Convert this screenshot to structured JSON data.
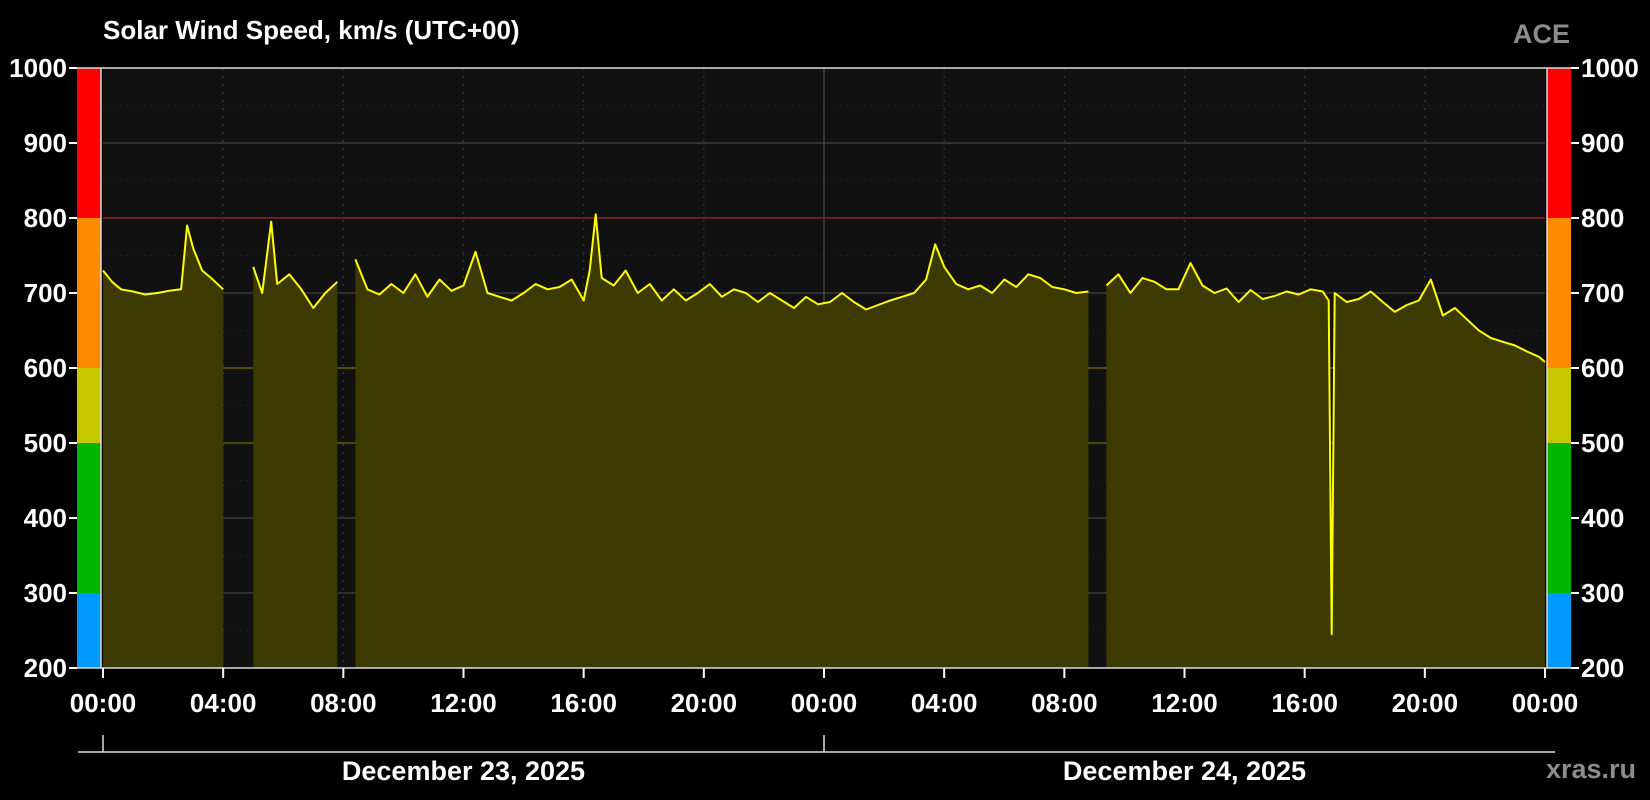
{
  "chart_data": {
    "type": "area",
    "title": "Solar Wind Speed, km/s (UTC+00)",
    "source_label": "ACE",
    "watermark": "xras.ru",
    "ylim": [
      200,
      1000
    ],
    "y_ticks": [
      200,
      300,
      400,
      500,
      600,
      700,
      800,
      900,
      1000
    ],
    "x_ticks": [
      "00:00",
      "04:00",
      "08:00",
      "12:00",
      "16:00",
      "20:00",
      "00:00",
      "04:00",
      "08:00",
      "12:00",
      "16:00",
      "20:00",
      "00:00"
    ],
    "x_range_hours": [
      0,
      48
    ],
    "date_labels": [
      {
        "label": "December 23, 2025",
        "start_hour": 0,
        "end_hour": 24
      },
      {
        "label": "December 24, 2025",
        "start_hour": 24,
        "end_hour": 48
      }
    ],
    "level_bands": [
      {
        "from": 200,
        "to": 300,
        "color": "#0099ff"
      },
      {
        "from": 300,
        "to": 500,
        "color": "#00b400"
      },
      {
        "from": 500,
        "to": 600,
        "color": "#c8c800"
      },
      {
        "from": 600,
        "to": 800,
        "color": "#ff8c00"
      },
      {
        "from": 800,
        "to": 1000,
        "color": "#ff0000"
      }
    ],
    "threshold_lines": [
      {
        "value": 800,
        "color": "#8b1a1a"
      },
      {
        "value": 600,
        "color": "#6b5a00"
      },
      {
        "value": 500,
        "color": "#5a5a00"
      }
    ],
    "colors": {
      "line": "#ffff00",
      "fill": "#3d3a00",
      "plot_background": "#111111",
      "grid": "#3a3a3a"
    },
    "grid": true,
    "series": [
      {
        "points": [
          [
            0.0,
            730
          ],
          [
            0.3,
            715
          ],
          [
            0.6,
            705
          ],
          [
            1.0,
            702
          ],
          [
            1.4,
            698
          ],
          [
            1.8,
            700
          ],
          [
            2.2,
            703
          ],
          [
            2.6,
            705
          ],
          [
            2.8,
            790
          ],
          [
            3.0,
            760
          ],
          [
            3.3,
            730
          ],
          [
            3.6,
            720
          ],
          [
            4.0,
            705
          ],
          [
            null,
            null
          ],
          [
            5.0,
            735
          ],
          [
            5.3,
            700
          ],
          [
            5.6,
            795
          ],
          [
            5.8,
            712
          ],
          [
            6.2,
            725
          ],
          [
            6.6,
            705
          ],
          [
            7.0,
            680
          ],
          [
            7.4,
            700
          ],
          [
            7.8,
            715
          ],
          [
            null,
            null
          ],
          [
            8.4,
            745
          ],
          [
            8.8,
            705
          ],
          [
            9.2,
            698
          ],
          [
            9.6,
            712
          ],
          [
            10.0,
            700
          ],
          [
            10.4,
            725
          ],
          [
            10.8,
            695
          ],
          [
            11.2,
            718
          ],
          [
            11.6,
            703
          ],
          [
            12.0,
            710
          ],
          [
            12.4,
            755
          ],
          [
            12.8,
            700
          ],
          [
            13.2,
            695
          ],
          [
            13.6,
            690
          ],
          [
            14.0,
            700
          ],
          [
            14.4,
            712
          ],
          [
            14.8,
            705
          ],
          [
            15.2,
            708
          ],
          [
            15.6,
            718
          ],
          [
            16.0,
            690
          ],
          [
            16.2,
            730
          ],
          [
            16.4,
            805
          ],
          [
            16.6,
            720
          ],
          [
            17.0,
            710
          ],
          [
            17.4,
            730
          ],
          [
            17.8,
            700
          ],
          [
            18.2,
            712
          ],
          [
            18.6,
            690
          ],
          [
            19.0,
            705
          ],
          [
            19.4,
            690
          ],
          [
            19.8,
            700
          ],
          [
            20.2,
            712
          ],
          [
            20.6,
            695
          ],
          [
            21.0,
            705
          ],
          [
            21.4,
            700
          ],
          [
            21.8,
            688
          ],
          [
            22.2,
            700
          ],
          [
            22.6,
            690
          ],
          [
            23.0,
            680
          ],
          [
            23.4,
            695
          ],
          [
            23.8,
            685
          ],
          [
            24.2,
            688
          ],
          [
            24.6,
            700
          ],
          [
            25.0,
            688
          ],
          [
            25.4,
            678
          ],
          [
            25.8,
            684
          ],
          [
            26.2,
            690
          ],
          [
            26.6,
            695
          ],
          [
            27.0,
            700
          ],
          [
            27.4,
            718
          ],
          [
            27.7,
            765
          ],
          [
            28.0,
            735
          ],
          [
            28.4,
            712
          ],
          [
            28.8,
            705
          ],
          [
            29.2,
            710
          ],
          [
            29.6,
            700
          ],
          [
            30.0,
            718
          ],
          [
            30.4,
            708
          ],
          [
            30.8,
            725
          ],
          [
            31.2,
            720
          ],
          [
            31.6,
            708
          ],
          [
            32.0,
            705
          ],
          [
            32.4,
            700
          ],
          [
            32.8,
            702
          ],
          [
            null,
            null
          ],
          [
            33.4,
            710
          ],
          [
            33.8,
            725
          ],
          [
            34.2,
            700
          ],
          [
            34.6,
            720
          ],
          [
            35.0,
            715
          ],
          [
            35.4,
            705
          ],
          [
            35.8,
            705
          ],
          [
            36.2,
            740
          ],
          [
            36.6,
            710
          ],
          [
            37.0,
            700
          ],
          [
            37.4,
            706
          ],
          [
            37.8,
            688
          ],
          [
            38.2,
            704
          ],
          [
            38.6,
            692
          ],
          [
            39.0,
            696
          ],
          [
            39.4,
            702
          ],
          [
            39.8,
            698
          ],
          [
            40.2,
            705
          ],
          [
            40.6,
            702
          ],
          [
            40.8,
            690
          ],
          [
            40.9,
            245
          ],
          [
            41.0,
            700
          ],
          [
            41.4,
            688
          ],
          [
            41.8,
            692
          ],
          [
            42.2,
            702
          ],
          [
            42.6,
            688
          ],
          [
            43.0,
            675
          ],
          [
            43.4,
            684
          ],
          [
            43.8,
            690
          ],
          [
            44.2,
            718
          ],
          [
            44.6,
            670
          ],
          [
            45.0,
            680
          ],
          [
            45.4,
            665
          ],
          [
            45.8,
            650
          ],
          [
            46.2,
            640
          ],
          [
            46.6,
            635
          ],
          [
            47.0,
            630
          ],
          [
            47.4,
            622
          ],
          [
            47.8,
            615
          ],
          [
            48.0,
            608
          ]
        ]
      }
    ]
  }
}
